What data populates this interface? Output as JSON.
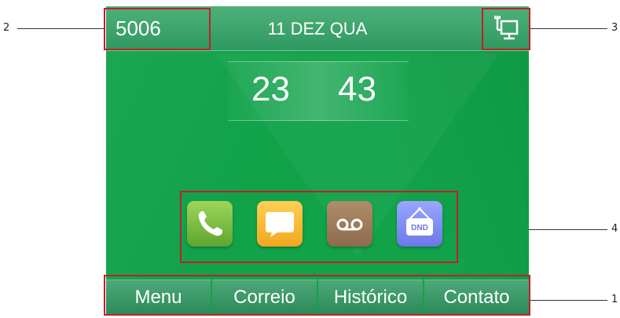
{
  "status_bar": {
    "account": "5006",
    "date": "11 DEZ QUA",
    "network_icon": "network-icon"
  },
  "clock": {
    "hours": "23",
    "minutes": "43"
  },
  "apps": [
    {
      "name": "call",
      "icon": "phone-icon",
      "color": "#7cc04a"
    },
    {
      "name": "message",
      "icon": "message-icon",
      "color": "#f6b837"
    },
    {
      "name": "voicemail",
      "icon": "voicemail-icon",
      "color": "#9c7a58"
    },
    {
      "name": "dnd",
      "icon": "dnd-icon",
      "label": "DND",
      "color": "#7f8cf0"
    }
  ],
  "softkeys": [
    {
      "label": "Menu"
    },
    {
      "label": "Correio"
    },
    {
      "label": "Histórico"
    },
    {
      "label": "Contato"
    }
  ],
  "callouts": [
    "1",
    "2",
    "3",
    "4"
  ],
  "colors": {
    "screen_bg": "#11a24a",
    "callout_box": "#c0202a"
  }
}
